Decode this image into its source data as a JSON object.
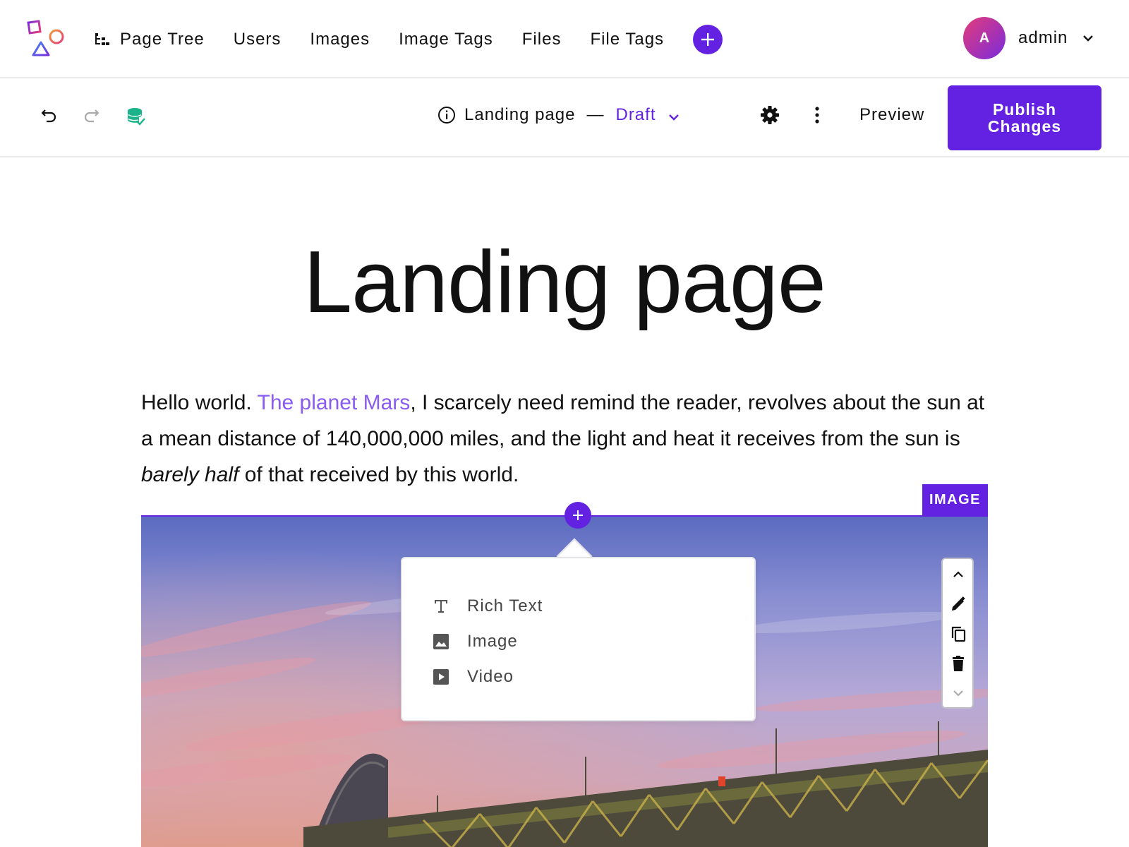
{
  "nav": {
    "items": [
      {
        "label": "Page Tree",
        "icon": "page-tree-icon"
      },
      {
        "label": "Users"
      },
      {
        "label": "Images"
      },
      {
        "label": "Image Tags"
      },
      {
        "label": "Files"
      },
      {
        "label": "File Tags"
      }
    ]
  },
  "user": {
    "initial": "A",
    "name": "admin"
  },
  "toolbar": {
    "page_name": "Landing page",
    "separator": "—",
    "status": "Draft",
    "preview_label": "Preview",
    "publish_label": "Publish Changes"
  },
  "content": {
    "title": "Landing page",
    "text_before_link": "Hello world. ",
    "link_text": "The planet Mars",
    "text_after_link": ", I scarcely need remind the reader, revolves about the sun at a mean distance of 140,000,000 miles, and the light and heat it receives from the sun is ",
    "italic_text": "barely half",
    "text_end": " of that received by this world.",
    "image_tag": "IMAGE"
  },
  "insert_menu": {
    "items": [
      {
        "label": "Rich Text",
        "icon": "text-icon"
      },
      {
        "label": "Image",
        "icon": "image-icon"
      },
      {
        "label": "Video",
        "icon": "video-icon"
      }
    ]
  },
  "colors": {
    "accent": "#6322e2",
    "link": "#8a5cf0",
    "saved_icon": "#1bb38a"
  }
}
